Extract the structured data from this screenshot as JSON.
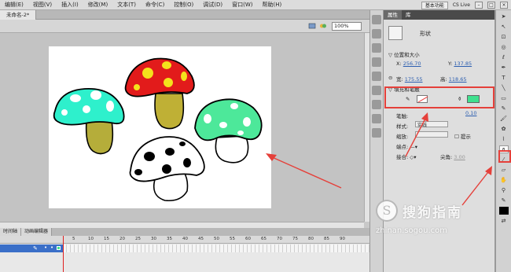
{
  "menubar": {
    "items": [
      "编辑(E)",
      "视图(V)",
      "插入(I)",
      "修改(M)",
      "文本(T)",
      "命令(C)",
      "控制(O)",
      "调试(D)",
      "窗口(W)",
      "帮助(H)"
    ],
    "workspace": "基本功能",
    "search": "CS Live"
  },
  "document": {
    "tab": "未命名-2*",
    "zoom": "100%"
  },
  "timeline": {
    "tabs": [
      "时间轴",
      "动画编辑器"
    ],
    "frame_numbers": [
      "5",
      "10",
      "15",
      "20",
      "25",
      "30",
      "35",
      "40",
      "45",
      "50",
      "55",
      "60",
      "65",
      "70",
      "75",
      "80",
      "85",
      "90"
    ]
  },
  "properties": {
    "tabs": [
      "属性",
      "库"
    ],
    "object_type": "形状",
    "section_position": "位置和大小",
    "x_label": "X:",
    "x_value": "256.70",
    "y_label": "Y:",
    "y_value": "137.85",
    "w_label": "宽:",
    "w_value": "175.55",
    "h_label": "高:",
    "h_value": "118.65",
    "section_fill": "填充和笔触",
    "stroke_label": "笔触:",
    "stroke_value": "0.10",
    "style_label": "样式:",
    "style_value": "实线",
    "scale_label": "缩放:",
    "hint_label": "提示",
    "cap_label": "端点:",
    "join_label": "接合:",
    "miter_label": "尖角:",
    "miter_value": "3.00"
  },
  "colors": {
    "fill": "#3fe08e",
    "highlight": "#e5403a"
  },
  "watermark": {
    "logo": "S",
    "text": "搜狗指南",
    "url": "zhinan.sogou.com"
  }
}
